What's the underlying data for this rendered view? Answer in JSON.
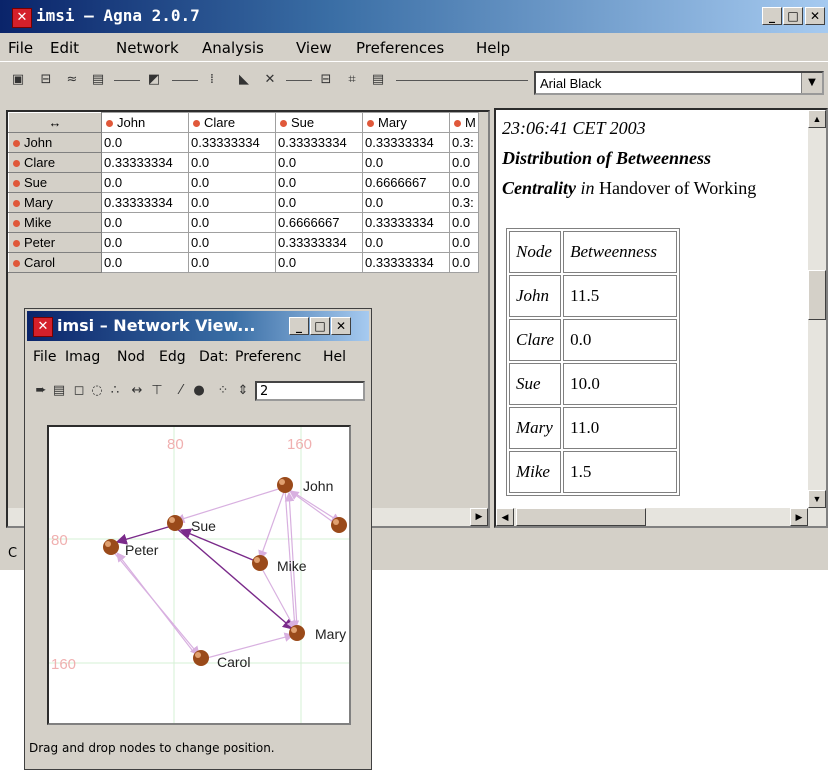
{
  "window": {
    "title": "imsi – Agna 2.0.7",
    "icon": "app-icon",
    "controls": [
      "_",
      "□",
      "X"
    ]
  },
  "menu": [
    "File",
    "Edit",
    "Network",
    "Analysis",
    "View",
    "Preferences",
    "Help"
  ],
  "toolbar": {
    "icons": [
      "new-icon",
      "open-icon",
      "network-icon",
      "save-icon",
      "edit-icon",
      "matrix-icon",
      "chart-icon",
      "graph-icon",
      "camera-icon",
      "export-icon",
      "print-icon"
    ],
    "font_select": "Arial Black"
  },
  "matrix": {
    "columns": [
      "John",
      "Clare",
      "Sue",
      "Mary",
      "M"
    ],
    "rows": [
      {
        "name": "John",
        "cells": [
          "0.0",
          "0.33333334",
          "0.33333334",
          "0.33333334",
          "0.3:"
        ]
      },
      {
        "name": "Clare",
        "cells": [
          "0.33333334",
          "0.0",
          "0.0",
          "0.0",
          "0.0"
        ]
      },
      {
        "name": "Sue",
        "cells": [
          "0.0",
          "0.0",
          "0.0",
          "0.6666667",
          "0.0"
        ]
      },
      {
        "name": "Mary",
        "cells": [
          "0.33333334",
          "0.0",
          "0.0",
          "0.0",
          "0.3:"
        ]
      },
      {
        "name": "Mike",
        "cells": [
          "0.0",
          "0.0",
          "0.6666667",
          "0.33333334",
          "0.0"
        ]
      },
      {
        "name": "Peter",
        "cells": [
          "0.0",
          "0.0",
          "0.33333334",
          "0.0",
          "0.0"
        ]
      },
      {
        "name": "Carol",
        "cells": [
          "0.0",
          "0.0",
          "0.0",
          "0.33333334",
          "0.0"
        ]
      }
    ]
  },
  "report": {
    "timestamp": "23:06:41 CET 2003",
    "heading_line1": "Distribution of Betweenness",
    "heading_bold": "Centrality",
    "heading_in": " in ",
    "heading_rest": "Handover of Working",
    "table_headers": [
      "Node",
      "Betweenness"
    ],
    "table_rows": [
      {
        "node": "John",
        "value": "11.5"
      },
      {
        "node": "Clare",
        "value": "0.0"
      },
      {
        "node": "Sue",
        "value": "10.0"
      },
      {
        "node": "Mary",
        "value": "11.0"
      },
      {
        "node": "Mike",
        "value": "1.5"
      }
    ]
  },
  "status_text": "C",
  "network_view": {
    "title": "imsi – Network View...",
    "menu": [
      "File",
      "Imag",
      "Nod",
      "Edg",
      "Dat:",
      "Preferenc",
      "Hel"
    ],
    "spinner_value": "2",
    "axis_labels": {
      "x1": "80",
      "x2": "160",
      "y1": "80",
      "y2": "160"
    },
    "nodes": [
      "John",
      "C",
      "Sue",
      "Peter",
      "Mike",
      "Mary",
      "Carol"
    ],
    "status": "Drag and drop nodes to change position.",
    "node_color": "#9a4a1a",
    "edge_color": "#d8b0e0",
    "strong_edge_color": "#7a2a8a"
  }
}
